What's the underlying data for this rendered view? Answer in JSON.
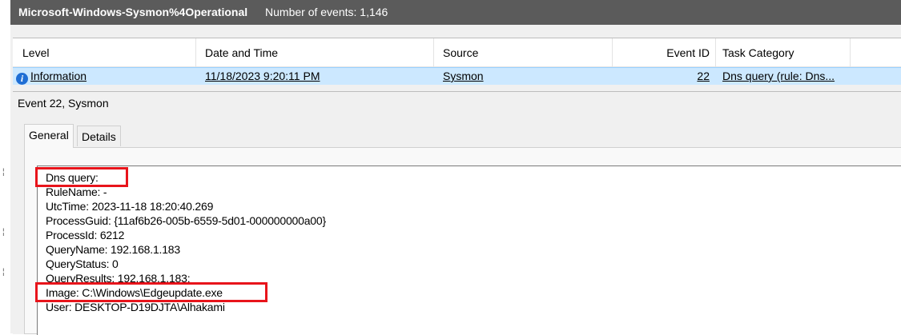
{
  "log": {
    "name": "Microsoft-Windows-Sysmon%4Operational",
    "count_text": "Number of events: 1,146"
  },
  "columns": [
    "Level",
    "Date and Time",
    "Source",
    "Event ID",
    "Task Category"
  ],
  "row": {
    "level_icon": "info-icon",
    "level": "Information",
    "date_time": "11/18/2023 9:20:11 PM",
    "source": "Sysmon",
    "event_id": "22",
    "task_category": "Dns query (rule: Dns..."
  },
  "detail": {
    "title": "Event 22, Sysmon",
    "tabs": [
      "General",
      "Details"
    ],
    "selected_tab": "General",
    "lines": [
      "Dns query:",
      "RuleName: -",
      "UtcTime: 2023-11-18 18:20:40.269",
      "ProcessGuid: {11af6b26-005b-6559-5d01-000000000a00}",
      "ProcessId: 6212",
      "QueryName: 192.168.1.183",
      "QueryStatus: 0",
      "QueryResults: 192.168.1.183;",
      "Image: C:\\Windows\\Edgeupdate.exe",
      "User: DESKTOP-D19DJTA\\Alhakami"
    ]
  },
  "colors": {
    "header_bg": "#5b5b5b",
    "selected_row": "#cce8ff",
    "highlight_box": "#e8141b",
    "info_icon": "#1f6ed4"
  }
}
